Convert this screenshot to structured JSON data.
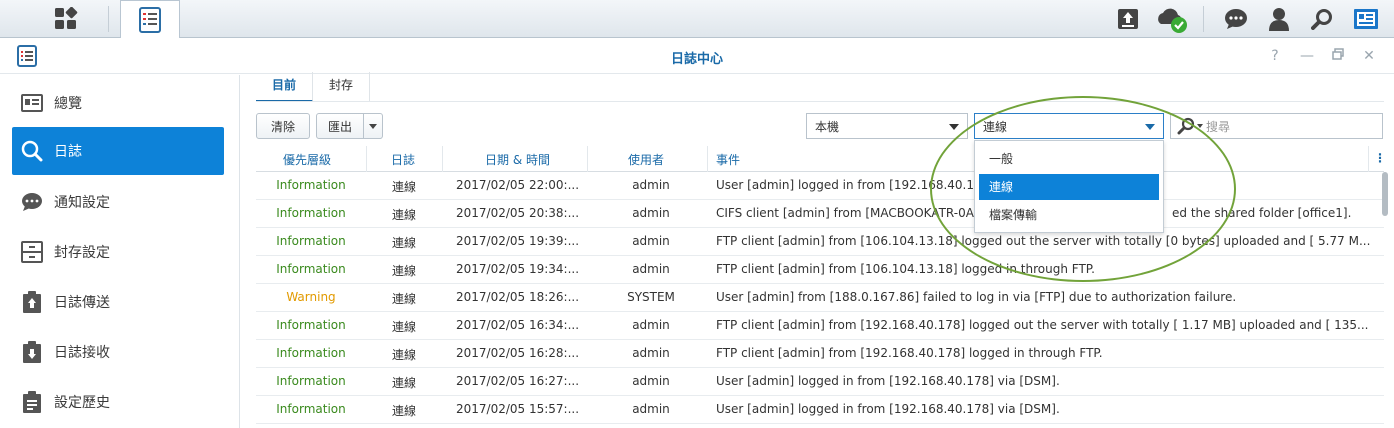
{
  "window": {
    "title": "日誌中心"
  },
  "tabs": [
    {
      "label": "目前"
    },
    {
      "label": "封存"
    }
  ],
  "sidebar": {
    "items": [
      {
        "label": "總覽",
        "icon": "overview-card-icon"
      },
      {
        "label": "日誌",
        "icon": "search-icon"
      },
      {
        "label": "通知設定",
        "icon": "chat-bubble-icon"
      },
      {
        "label": "封存設定",
        "icon": "archive-box-icon"
      },
      {
        "label": "日誌傳送",
        "icon": "upload-clipboard-icon"
      },
      {
        "label": "日誌接收",
        "icon": "download-clipboard-icon"
      },
      {
        "label": "設定歷史",
        "icon": "history-clipboard-icon"
      }
    ],
    "active_index": 1
  },
  "toolbar": {
    "clear_label": "清除",
    "export_label": "匯出",
    "source_select": "本機",
    "type_select": "連線",
    "search_placeholder": "搜尋"
  },
  "dropdown": {
    "options": [
      "一般",
      "連線",
      "檔案傳輸"
    ],
    "selected_index": 1
  },
  "table": {
    "columns": [
      "優先層級",
      "日誌",
      "日期 & 時間",
      "使用者",
      "事件"
    ],
    "rows": [
      {
        "priority": "Information",
        "log": "連線",
        "datetime": "2017/02/05 22:00:...",
        "user": "admin",
        "event": "User [admin] logged in from [192.168.40.1"
      },
      {
        "priority": "Information",
        "log": "連線",
        "datetime": "2017/02/05 20:38:...",
        "user": "admin",
        "event": "CIFS client [admin] from [MACBOOKATR-0A"
      },
      {
        "priority": "Information",
        "log": "連線",
        "datetime": "2017/02/05 19:39:...",
        "user": "admin",
        "event": "FTP client [admin] from [106.104.13.18] logged out the server with totally [0 bytes] uploaded and [ 5.77 M..."
      },
      {
        "priority": "Information",
        "log": "連線",
        "datetime": "2017/02/05 19:34:...",
        "user": "admin",
        "event": "FTP client [admin] from [106.104.13.18] logged in through FTP."
      },
      {
        "priority": "Warning",
        "log": "連線",
        "datetime": "2017/02/05 18:26:...",
        "user": "SYSTEM",
        "event": "User [admin] from [188.0.167.86] failed to log in via [FTP] due to authorization failure."
      },
      {
        "priority": "Information",
        "log": "連線",
        "datetime": "2017/02/05 16:34:...",
        "user": "admin",
        "event": "FTP client [admin] from [192.168.40.178] logged out the server with totally [ 1.17 MB] uploaded and [ 135..."
      },
      {
        "priority": "Information",
        "log": "連線",
        "datetime": "2017/02/05 16:28:...",
        "user": "admin",
        "event": "FTP client [admin] from [192.168.40.178] logged in through FTP."
      },
      {
        "priority": "Information",
        "log": "連線",
        "datetime": "2017/02/05 16:27:...",
        "user": "admin",
        "event": "User [admin] logged in from [192.168.40.178] via [DSM]."
      },
      {
        "priority": "Information",
        "log": "連線",
        "datetime": "2017/02/05 15:57:...",
        "user": "admin",
        "event": "User [admin] logged in from [192.168.40.178] via [DSM]."
      }
    ],
    "row2_tail": "ed the shared folder [office1]."
  },
  "colors": {
    "accent": "#0d82d8",
    "info": "#3a8a1e",
    "warning": "#e29a00",
    "annotation": "#72a33a"
  }
}
